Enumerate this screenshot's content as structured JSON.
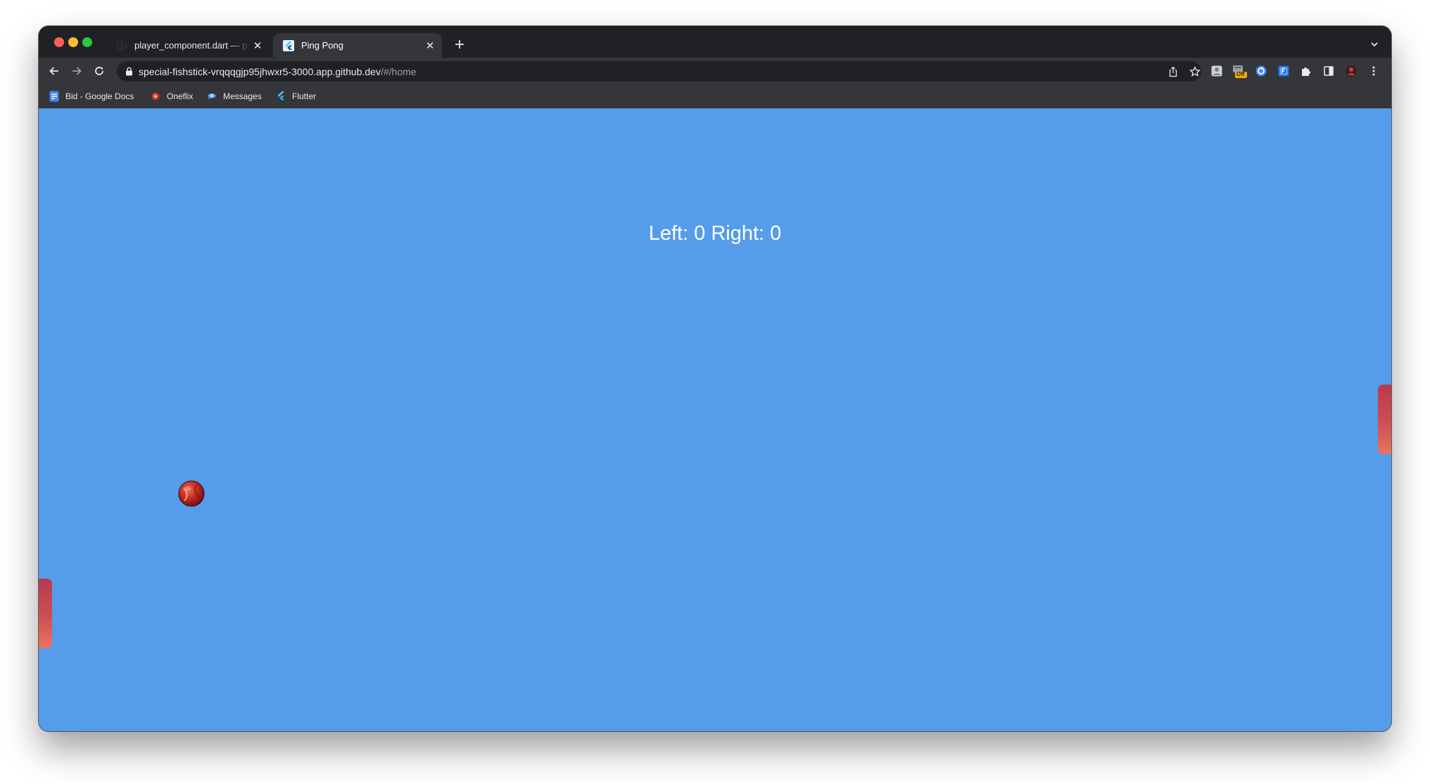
{
  "browser": {
    "tabs": [
      {
        "title": "player_component.dart — pong",
        "favicon": "github-icon",
        "active": false
      },
      {
        "title": "Ping Pong",
        "favicon": "flutter-icon",
        "active": true
      }
    ],
    "new_tab_symbol": "+",
    "tab_close_symbol": "✕",
    "address": {
      "host": "special-fishstick-vrqqqgjp95jhwxr5-3000.app.github.dev",
      "path": "/#/home"
    },
    "extension_badge": "Off",
    "bookmarks": [
      {
        "label": "Bid - Google Docs",
        "icon": "google-docs-icon"
      },
      {
        "label": "Oneflix",
        "icon": "oneflix-icon"
      },
      {
        "label": "Messages",
        "icon": "messages-icon"
      },
      {
        "label": "Flutter",
        "icon": "flutter-icon"
      }
    ]
  },
  "game": {
    "score_text": "Left: 0 Right: 0",
    "background_color": "#559cea",
    "paddle_color": "#c9474f"
  }
}
